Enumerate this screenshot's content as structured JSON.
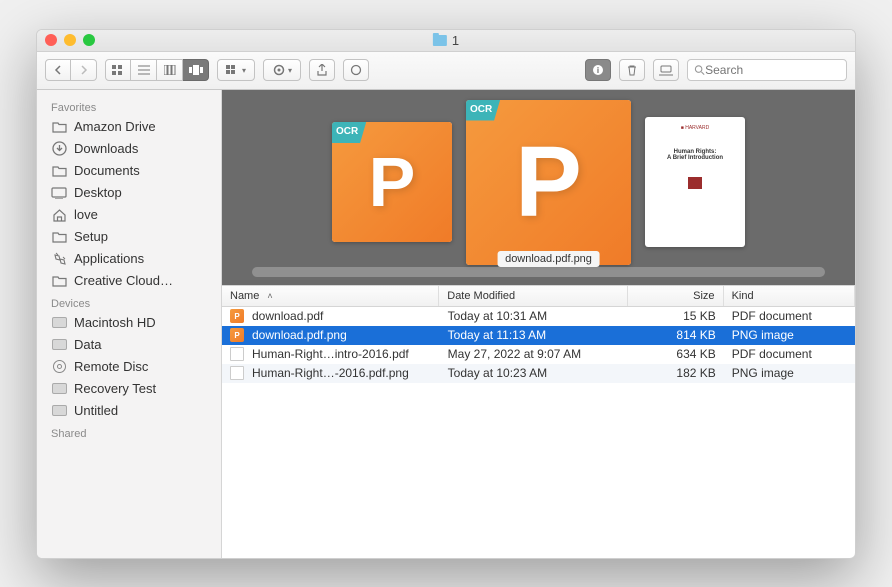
{
  "window": {
    "title": "1"
  },
  "toolbar": {
    "search_placeholder": "Search"
  },
  "sidebar": {
    "sections": [
      {
        "label": "Favorites",
        "items": [
          {
            "label": "Amazon Drive",
            "icon": "folder-icon"
          },
          {
            "label": "Downloads",
            "icon": "download-icon"
          },
          {
            "label": "Documents",
            "icon": "folder-icon"
          },
          {
            "label": "Desktop",
            "icon": "desktop-icon"
          },
          {
            "label": "love",
            "icon": "home-icon"
          },
          {
            "label": "Setup",
            "icon": "folder-icon"
          },
          {
            "label": "Applications",
            "icon": "applications-icon"
          },
          {
            "label": "Creative Cloud…",
            "icon": "folder-icon"
          }
        ]
      },
      {
        "label": "Devices",
        "items": [
          {
            "label": "Macintosh HD",
            "icon": "hd-icon"
          },
          {
            "label": "Data",
            "icon": "hd-icon"
          },
          {
            "label": "Remote Disc",
            "icon": "disc-icon"
          },
          {
            "label": "Recovery Test",
            "icon": "hd-icon"
          },
          {
            "label": "Untitled",
            "icon": "hd-icon"
          }
        ]
      },
      {
        "label": "Shared",
        "items": []
      }
    ]
  },
  "preview": {
    "selected_label": "download.pdf.png"
  },
  "columns": {
    "name": "Name",
    "date": "Date Modified",
    "size": "Size",
    "kind": "Kind"
  },
  "files": [
    {
      "name": "download.pdf",
      "date": "Today at 10:31 AM",
      "size": "15 KB",
      "kind": "PDF document",
      "icon": "pdf",
      "selected": false
    },
    {
      "name": "download.pdf.png",
      "date": "Today at 11:13 AM",
      "size": "814 KB",
      "kind": "PNG image",
      "icon": "pdf",
      "selected": true
    },
    {
      "name": "Human-Right…intro-2016.pdf",
      "date": "May 27, 2022 at 9:07 AM",
      "size": "634 KB",
      "kind": "PDF document",
      "icon": "png",
      "selected": false
    },
    {
      "name": "Human-Right…-2016.pdf.png",
      "date": "Today at 10:23 AM",
      "size": "182 KB",
      "kind": "PNG image",
      "icon": "png",
      "selected": false
    }
  ]
}
